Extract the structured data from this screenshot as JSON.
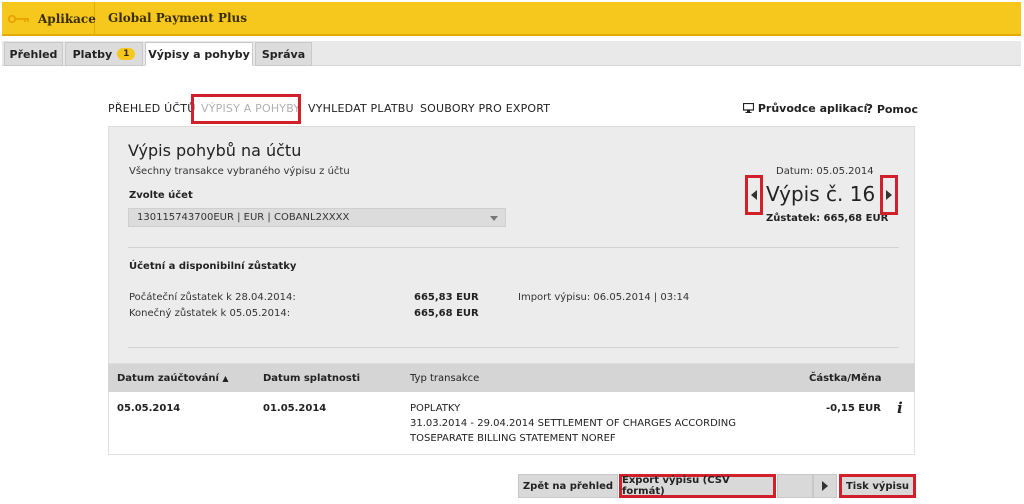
{
  "appbar": {
    "apps_label": "Aplikace",
    "product": "Global Payment Plus"
  },
  "tabs": [
    {
      "label": "Přehled"
    },
    {
      "label": "Platby",
      "badge": "1"
    },
    {
      "label": "Výpisy a pohyby"
    },
    {
      "label": "Správa"
    }
  ],
  "subnav": {
    "items": [
      "PŘEHLED ÚČTŮ",
      "VÝPISY A POHYBY",
      "VYHLEDAT PLATBU",
      "SOUBORY PRO EXPORT"
    ],
    "guide": "Průvodce aplikací",
    "help": "Pomoc"
  },
  "panel": {
    "title": "Výpis pohybů na účtu",
    "subtitle": "Všechny transakce vybraného výpisu z účtu",
    "account_label": "Zvolte účet",
    "account_value": "130115743700EUR | EUR | COBANL2XXXX",
    "statement": {
      "date": "Datum: 05.05.2014",
      "number": "Výpis č. 16",
      "balance": "Zůstatek: 665,68 EUR"
    },
    "balances_title": "Účetní a disponibilní zůstatky",
    "opening_label": "Počáteční zůstatek k 28.04.2014:",
    "opening_value": "665,83 EUR",
    "closing_label": "Konečný zůstatek k 05.05.2014:",
    "closing_value": "665,68 EUR",
    "import": "Import výpisu: 06.05.2014 | 03:14"
  },
  "table": {
    "headers": [
      "Datum zaúčtování",
      "Datum splatnosti",
      "Typ transakce",
      "Částka/Měna"
    ],
    "rows": [
      {
        "posting_date": "05.05.2014",
        "due_date": "01.05.2014",
        "type": "POPLATKY",
        "desc1": "31.03.2014 - 29.04.2014 SETTLEMENT OF CHARGES ACCORDING",
        "desc2": "TOSEPARATE BILLING STATEMENT NOREF",
        "amount": "-0,15 EUR"
      }
    ]
  },
  "buttons": {
    "back": "Zpět na přehled",
    "export": "Export výpisu (CSV formát)",
    "print": "Tisk výpisu"
  },
  "colors": {
    "brand_yellow": "#f6c81e",
    "highlight_red": "#d2202b",
    "panel_grey": "#ececec"
  }
}
